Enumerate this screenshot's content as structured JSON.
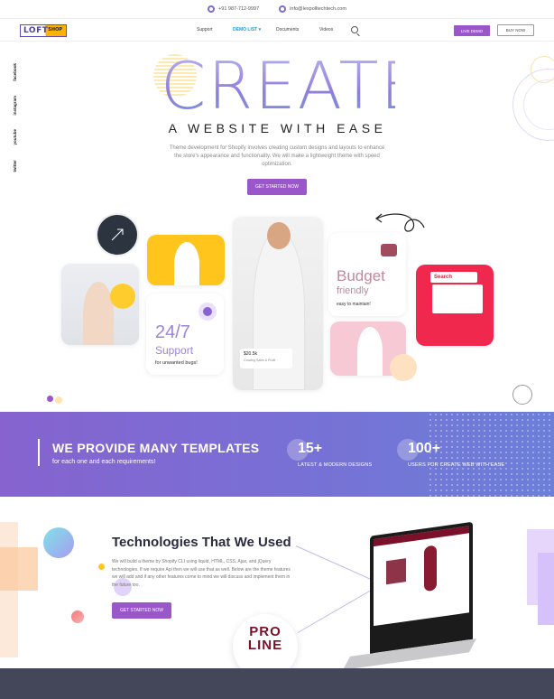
{
  "topbar": {
    "phone": "+91 987-712-9997",
    "email": "info@lexpolltechtech.com"
  },
  "header": {
    "logo_text": "LOFT",
    "logo_sub": "SHOP",
    "nav": [
      "Support",
      "DEMO LIST ▾",
      "Documents",
      "Videos"
    ],
    "live_demo_label": "LIVE DEMO",
    "buy_now_label": "BUY NOW"
  },
  "social": [
    "facebook",
    "instagram",
    "youtube",
    "twitter"
  ],
  "hero": {
    "title": "CREATE",
    "subtitle": "A WEBSITE WITH EASE",
    "description": "Theme development for Shopify involves creating custom designs and layouts to enhance the store's appearance and functionality. We will make a lightweight theme with speed optimization.",
    "cta_label": "GET STARTED NOW"
  },
  "cards": {
    "support_big": "24/7",
    "support_word": "Support",
    "support_small": "for unwanted bugs!",
    "budget_big": "Budget",
    "budget_word": "friendly",
    "budget_small": "easy to maintain!",
    "stat_value": "$20.5k",
    "stat_label": "Growing Sales & Profit",
    "search_label": "Search"
  },
  "band": {
    "heading": "WE PROVIDE MANY TEMPLATES",
    "subheading": "for each one and each requirements!",
    "stats": [
      {
        "num": "15+",
        "label": "LATEST & MODERN DESIGNS"
      },
      {
        "num": "100+",
        "label": "USERS FOR CREATE WEB WITH EASE"
      }
    ]
  },
  "tech": {
    "title": "Technologies That We Used",
    "description": "We will build a theme by Shopify CLI using liquid, HTML, CSS, Ajax, and jQuery technologies. If we require Api then we will use that as well. Below are the theme features we will add and if any other features come to mind we will discuss and implement them in the future too.",
    "cta_label": "GET STARTED NOW",
    "brand_text": "PRO LINE"
  },
  "colors": {
    "accent_purple": "#9a57c9",
    "band_start": "#8663cf",
    "band_end": "#6b7fd8",
    "footer": "#44475a"
  }
}
